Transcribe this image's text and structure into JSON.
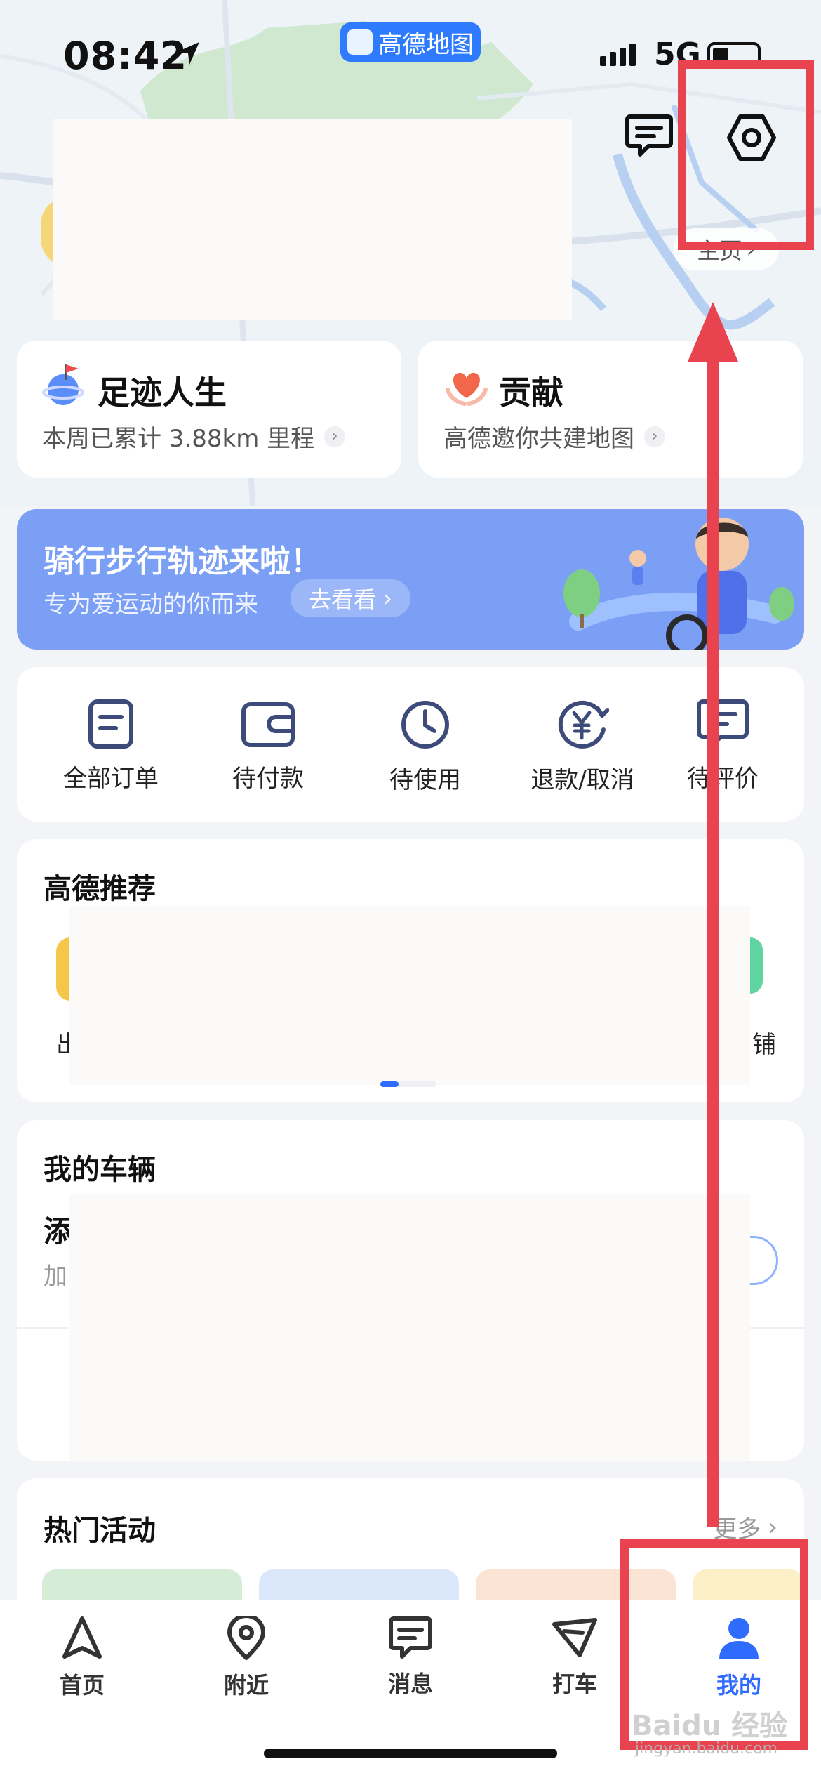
{
  "status_bar": {
    "time": "08:42",
    "app_badge": "高德地图",
    "network": "5G"
  },
  "header": {
    "homepage_link": "主页"
  },
  "features": [
    {
      "title": "足迹人生",
      "subtitle": "本周已累计 3.88km 里程"
    },
    {
      "title": "贡献",
      "subtitle": "高德邀你共建地图"
    }
  ],
  "banner": {
    "title": "骑行步行轨迹来啦！",
    "subtitle": "专为爱运动的你而来",
    "button": "去看看"
  },
  "orders": [
    {
      "label": "全部订单",
      "icon": "document-icon"
    },
    {
      "label": "待付款",
      "icon": "wallet-icon"
    },
    {
      "label": "待使用",
      "icon": "clock-icon"
    },
    {
      "label": "退款/取消",
      "icon": "yuan-refund-icon"
    },
    {
      "label": "待评价",
      "icon": "comment-icon"
    }
  ],
  "recommend": {
    "title": "高德推荐",
    "left_char": "出",
    "right_char": "铺"
  },
  "vehicle": {
    "title": "我的车辆",
    "line1_char": "添",
    "line2_char": "加"
  },
  "activities": {
    "title": "热门活动",
    "more": "更多"
  },
  "tabs": [
    {
      "label": "首页",
      "icon": "navigate-arrow-icon"
    },
    {
      "label": "附近",
      "icon": "location-pin-icon"
    },
    {
      "label": "消息",
      "icon": "message-icon"
    },
    {
      "label": "打车",
      "icon": "taxi-flag-icon"
    },
    {
      "label": "我的",
      "icon": "person-icon",
      "active": true
    }
  ],
  "colors": {
    "accent": "#2f6bff",
    "banner": "#7b9ff4",
    "annotation": "#e8434f"
  },
  "watermark": {
    "brand": "Baidu 经验",
    "url": "jingyan.baidu.com"
  }
}
